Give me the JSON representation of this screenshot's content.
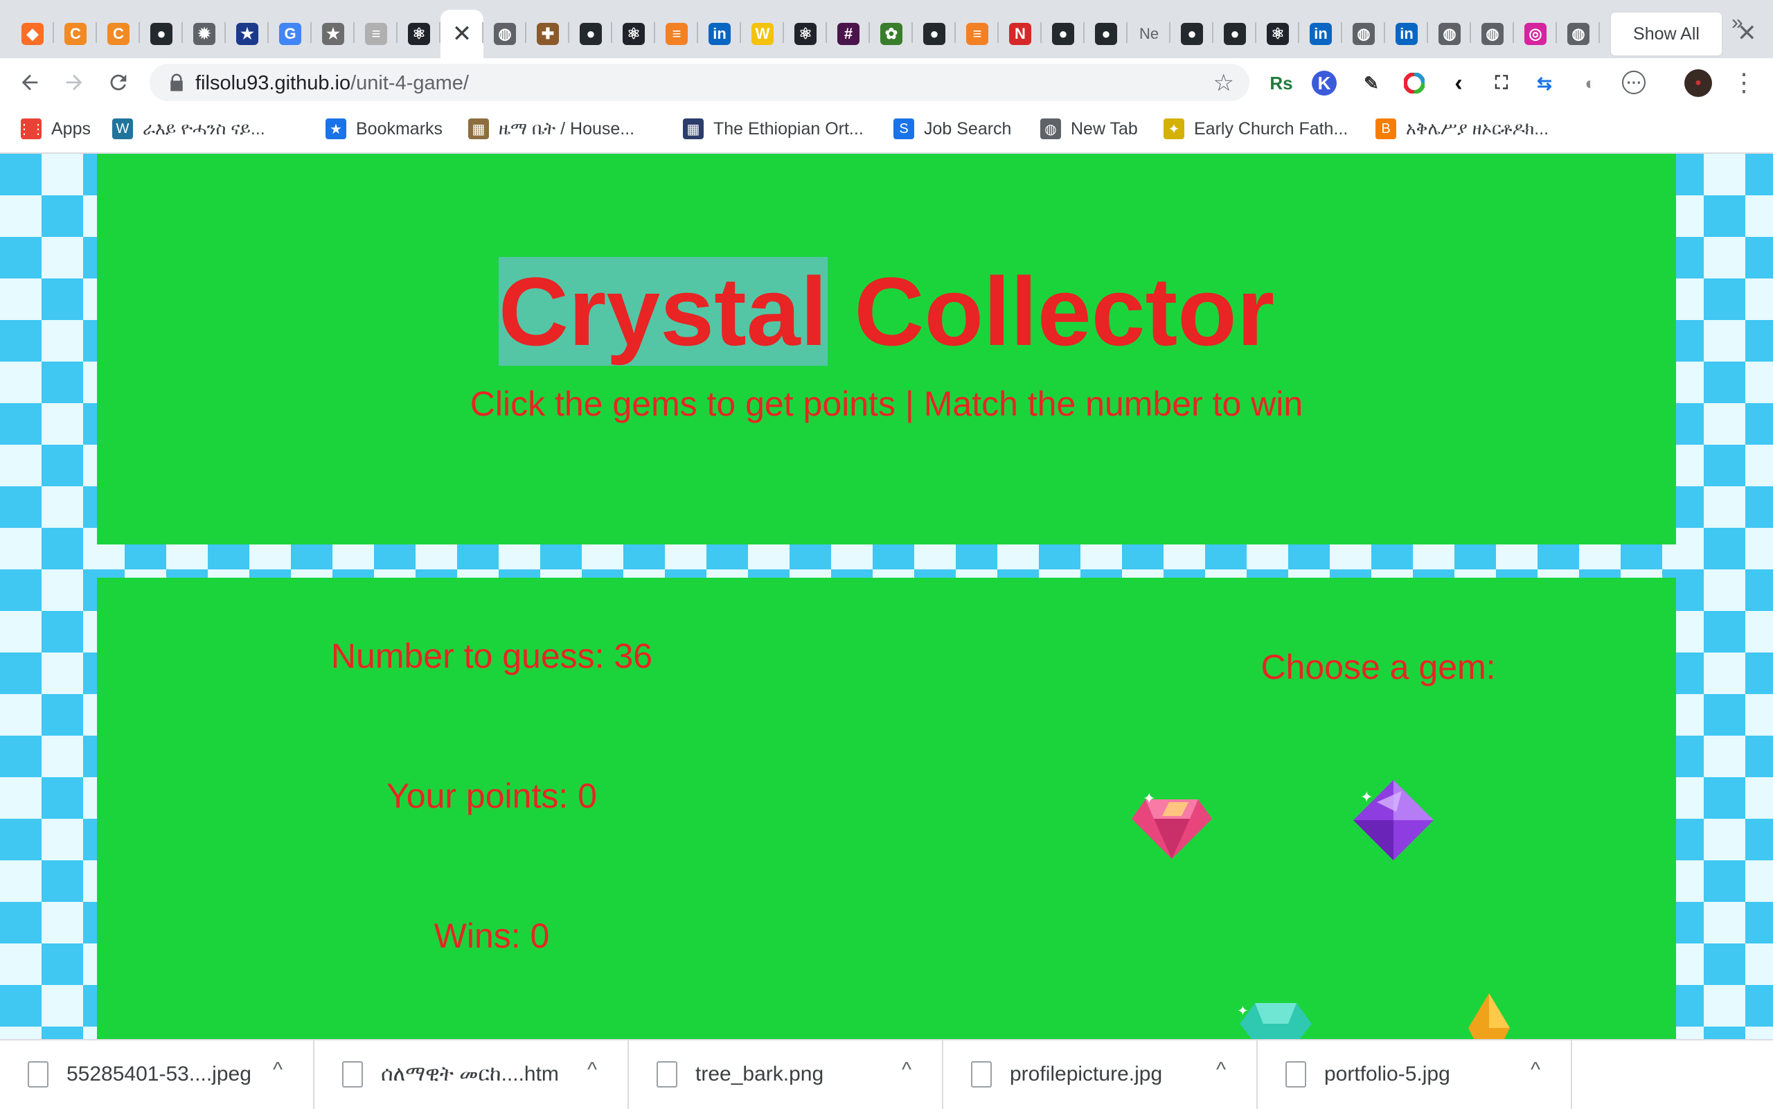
{
  "browser": {
    "tabs": [
      {
        "icon": "gitlab-icon",
        "color": "#fc6d26",
        "glyph": "◆"
      },
      {
        "icon": "codecademy-icon",
        "color": "#f08a24",
        "glyph": "C"
      },
      {
        "icon": "codecademy-icon",
        "color": "#f08a24",
        "glyph": "C"
      },
      {
        "icon": "github-icon",
        "color": "#24292e",
        "glyph": "●"
      },
      {
        "icon": "settings-gear-icon",
        "color": "#5f6368",
        "glyph": "✹"
      },
      {
        "icon": "star-badge-icon",
        "color": "#1b3a8c",
        "glyph": "★"
      },
      {
        "icon": "google-icon",
        "color": "#4285f4",
        "glyph": "G"
      },
      {
        "icon": "bookmark-star-icon",
        "color": "#6d6d6d",
        "glyph": "★"
      },
      {
        "icon": "stack-icon",
        "color": "#b0b0b0",
        "glyph": "≡"
      },
      {
        "icon": "react-icon",
        "color": "#20232a",
        "glyph": "⚛"
      },
      {
        "icon": "close-icon",
        "active": true,
        "glyph": "✕"
      },
      {
        "icon": "globe-icon",
        "color": "#5f6368",
        "glyph": "◍"
      },
      {
        "icon": "puzzle-icon",
        "color": "#8a5a2b",
        "glyph": "✚"
      },
      {
        "icon": "github-icon",
        "color": "#24292e",
        "glyph": "●"
      },
      {
        "icon": "react-icon",
        "color": "#20232a",
        "glyph": "⚛"
      },
      {
        "icon": "stackoverflow-icon",
        "color": "#f48024",
        "glyph": "≡"
      },
      {
        "icon": "linkedin-icon",
        "color": "#0a66c2",
        "glyph": "in"
      },
      {
        "icon": "w-icon",
        "color": "#f4c20d",
        "glyph": "W"
      },
      {
        "icon": "react-icon",
        "color": "#20232a",
        "glyph": "⚛"
      },
      {
        "icon": "slack-icon",
        "color": "#4a154b",
        "glyph": "#"
      },
      {
        "icon": "leaf-icon",
        "color": "#3a7d2c",
        "glyph": "✿"
      },
      {
        "icon": "github-icon",
        "color": "#24292e",
        "glyph": "●"
      },
      {
        "icon": "stackoverflow-icon",
        "color": "#f48024",
        "glyph": "≡"
      },
      {
        "icon": "n-icon",
        "color": "#d62828",
        "glyph": "N"
      },
      {
        "icon": "github-icon",
        "color": "#24292e",
        "glyph": "●"
      },
      {
        "icon": "github-icon",
        "color": "#24292e",
        "glyph": "●"
      },
      {
        "icon": "text-tab-icon",
        "color": "#5f6368",
        "glyph": "Ne",
        "text": true
      },
      {
        "icon": "github-icon",
        "color": "#24292e",
        "glyph": "●"
      },
      {
        "icon": "github-icon",
        "color": "#24292e",
        "glyph": "●"
      },
      {
        "icon": "react-icon",
        "color": "#20232a",
        "glyph": "⚛"
      },
      {
        "icon": "linkedin-icon",
        "color": "#0a66c2",
        "glyph": "in"
      },
      {
        "icon": "globe-icon",
        "color": "#5f6368",
        "glyph": "◍"
      },
      {
        "icon": "linkedin-icon",
        "color": "#0a66c2",
        "glyph": "in"
      },
      {
        "icon": "globe-icon",
        "color": "#5f6368",
        "glyph": "◍"
      },
      {
        "icon": "globe-icon",
        "color": "#5f6368",
        "glyph": "◍"
      },
      {
        "icon": "instagram-icon",
        "color": "#d6249f",
        "glyph": "◎"
      },
      {
        "icon": "globe-icon",
        "color": "#5f6368",
        "glyph": "◍"
      },
      {
        "icon": "globe-icon",
        "color": "#5f6368",
        "glyph": "◍"
      }
    ],
    "url_host": "filsolu93.github.io",
    "url_path": "/unit-4-game/",
    "bookmarks": [
      {
        "label": "Apps",
        "icon": "apps-grid-icon",
        "color": "#ea4335",
        "glyph": "⋮⋮"
      },
      {
        "label": "ራእይ ዮሓንስ ናይ...",
        "icon": "wordpress-icon",
        "color": "#21759b",
        "glyph": "W"
      },
      {
        "label": "Bookmarks",
        "icon": "star-icon",
        "color": "#1a73e8",
        "glyph": "★"
      },
      {
        "label": "ዜማ ቤት / House...",
        "icon": "house-image-icon",
        "color": "#8d6e3f",
        "glyph": "▦"
      },
      {
        "label": "The Ethiopian Ort...",
        "icon": "grid-icon",
        "color": "#2b3d6b",
        "glyph": "▦"
      },
      {
        "label": "Job Search",
        "icon": "sap-icon",
        "color": "#1a73e8",
        "glyph": "S"
      },
      {
        "label": "New Tab",
        "icon": "globe-icon",
        "color": "#5f6368",
        "glyph": "◍"
      },
      {
        "label": "Early Church Fath...",
        "icon": "emblem-icon",
        "color": "#d4b106",
        "glyph": "✦"
      },
      {
        "label": "አቅሌሥያ ዘኦርቶዶክ...",
        "icon": "blogger-icon",
        "color": "#f57d00",
        "glyph": "B"
      }
    ]
  },
  "game": {
    "title_word1": "Crystal",
    "title_word2": "Collector",
    "subtitle": "Click the gems to get points | Match the number to win",
    "number_to_guess_label": "Number to guess:",
    "number_to_guess": "36",
    "points_label": "Your points:",
    "points": "0",
    "wins_label": "Wins:",
    "wins": "0",
    "choose_label": "Choose a gem:",
    "colors": {
      "panel": "#1bd43c",
      "text": "#e82424",
      "highlight": "#54c6a6"
    }
  },
  "downloads": {
    "items": [
      {
        "name": "55285401-53....jpeg",
        "icon": "jpeg-file-icon"
      },
      {
        "name": "ሰለማዊት መርከ....htm",
        "icon": "chrome-file-icon"
      },
      {
        "name": "tree_bark.png",
        "icon": "png-file-icon"
      },
      {
        "name": "profilepicture.jpg",
        "icon": "jpg-file-icon"
      },
      {
        "name": "portfolio-5.jpg",
        "icon": "jpg-file-icon"
      }
    ],
    "show_all": "Show All"
  }
}
